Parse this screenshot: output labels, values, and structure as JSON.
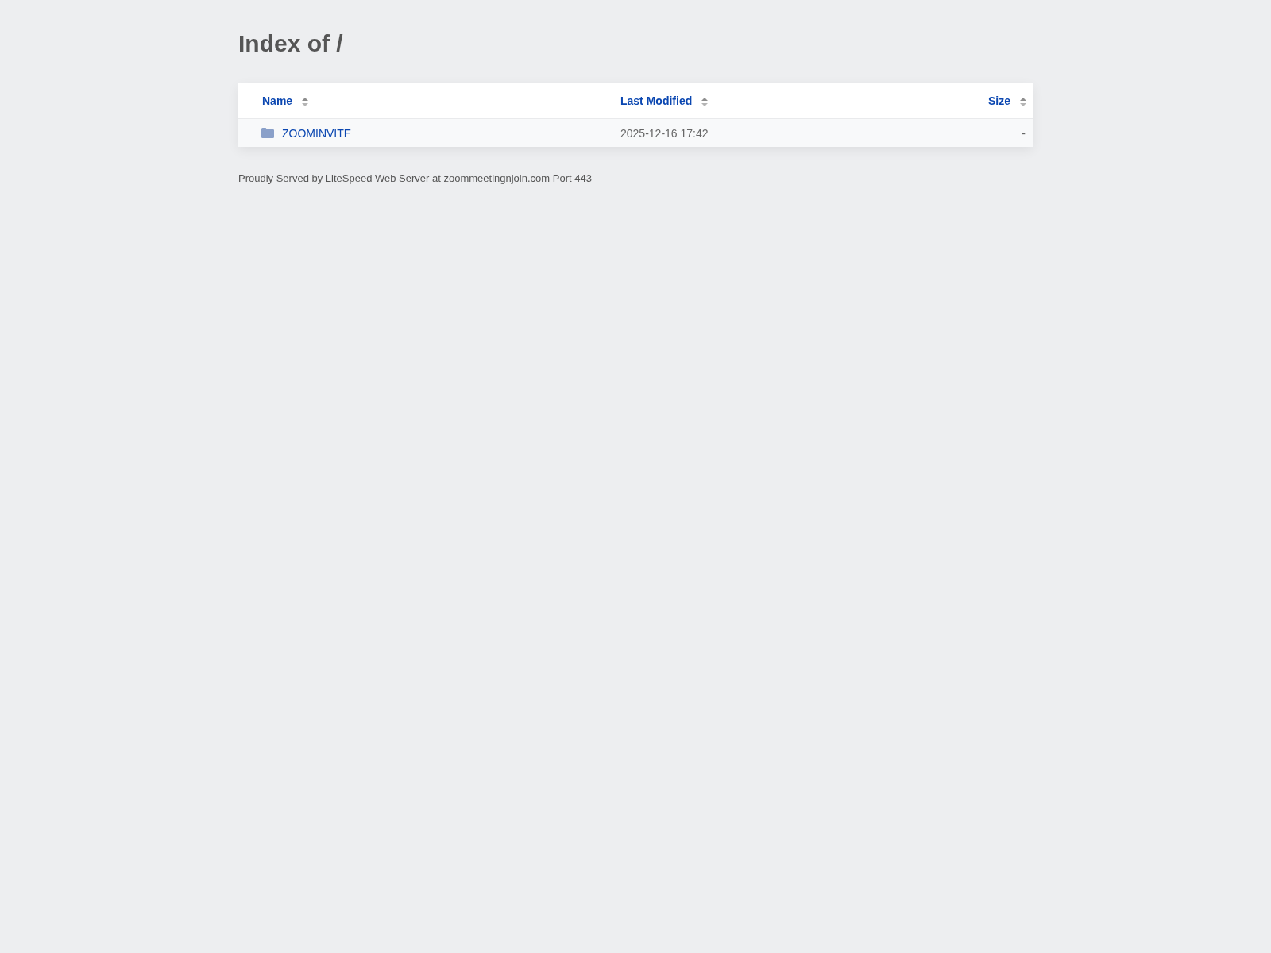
{
  "title": "Index of /",
  "table": {
    "columns": [
      {
        "label": "Name"
      },
      {
        "label": "Last Modified"
      },
      {
        "label": "Size"
      }
    ],
    "rows": [
      {
        "kind": "folder",
        "name": "ZOOMINVITE",
        "last_modified": "2025-12-16 17:42",
        "size": "-"
      }
    ]
  },
  "footer": "Proudly Served by LiteSpeed Web Server at zoommeetingnjoin.com Port 443"
}
